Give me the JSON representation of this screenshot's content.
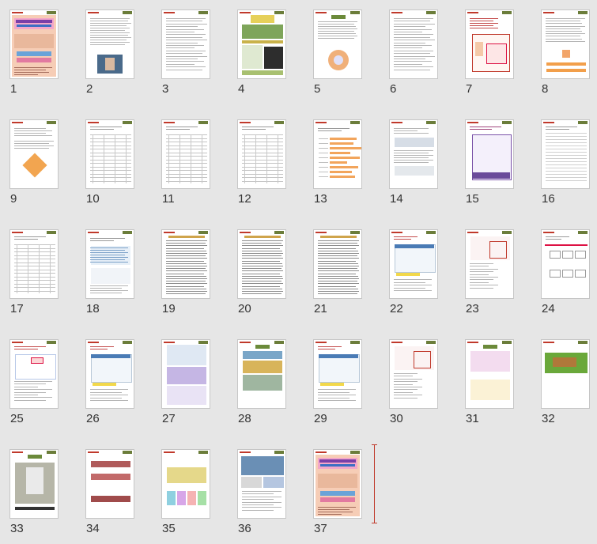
{
  "slides": [
    {
      "num": "1",
      "style": "title"
    },
    {
      "num": "2",
      "style": "text-photo"
    },
    {
      "num": "3",
      "style": "text"
    },
    {
      "num": "4",
      "style": "grid-image"
    },
    {
      "num": "5",
      "style": "circle"
    },
    {
      "num": "6",
      "style": "text"
    },
    {
      "num": "7",
      "style": "form"
    },
    {
      "num": "8",
      "style": "form-orange"
    },
    {
      "num": "9",
      "style": "radar"
    },
    {
      "num": "10",
      "style": "table"
    },
    {
      "num": "11",
      "style": "table"
    },
    {
      "num": "12",
      "style": "table"
    },
    {
      "num": "13",
      "style": "barchart"
    },
    {
      "num": "14",
      "style": "text-box"
    },
    {
      "num": "15",
      "style": "screen-purple"
    },
    {
      "num": "16",
      "style": "lines"
    },
    {
      "num": "17",
      "style": "table"
    },
    {
      "num": "18",
      "style": "text-blue"
    },
    {
      "num": "19",
      "style": "dense-text"
    },
    {
      "num": "20",
      "style": "dense-text"
    },
    {
      "num": "21",
      "style": "dense-text"
    },
    {
      "num": "22",
      "style": "screen-small"
    },
    {
      "num": "23",
      "style": "screen-red"
    },
    {
      "num": "24",
      "style": "diagram"
    },
    {
      "num": "25",
      "style": "flow"
    },
    {
      "num": "26",
      "style": "screen-small"
    },
    {
      "num": "27",
      "style": "screen-purple-large"
    },
    {
      "num": "28",
      "style": "screen-game"
    },
    {
      "num": "29",
      "style": "screen-small"
    },
    {
      "num": "30",
      "style": "screen-red"
    },
    {
      "num": "31",
      "style": "game-pink"
    },
    {
      "num": "32",
      "style": "game-map"
    },
    {
      "num": "33",
      "style": "game-3d"
    },
    {
      "num": "34",
      "style": "screen-strips"
    },
    {
      "num": "35",
      "style": "cards"
    },
    {
      "num": "36",
      "style": "collage"
    },
    {
      "num": "37",
      "style": "title"
    }
  ],
  "colors": {
    "background": "#e6e6e6",
    "slide_border": "#c6c6c6",
    "caret": "#c0392b",
    "label": "#333333"
  }
}
